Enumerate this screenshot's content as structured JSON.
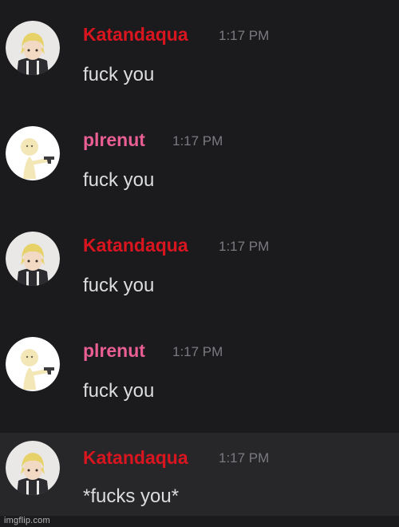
{
  "messages": [
    {
      "author": "Katandaqua",
      "author_color": "#d9151f",
      "time": "1:17 PM",
      "text": "fuck you",
      "avatar": "katandaqua-avatar"
    },
    {
      "author": "plrenut",
      "author_color": "#ea5f93",
      "time": "1:17 PM",
      "text": "fuck you",
      "avatar": "plrenut-avatar"
    },
    {
      "author": "Katandaqua",
      "author_color": "#d9151f",
      "time": "1:17 PM",
      "text": "fuck you",
      "avatar": "katandaqua-avatar"
    },
    {
      "author": "plrenut",
      "author_color": "#ea5f93",
      "time": "1:17 PM",
      "text": "fuck you",
      "avatar": "plrenut-avatar"
    },
    {
      "author": "Katandaqua",
      "author_color": "#d9151f",
      "time": "1:17 PM",
      "text": "*fucks you*",
      "avatar": "katandaqua-avatar"
    }
  ],
  "colors": {
    "background": "#1b1b1d",
    "hover_background": "#27272a",
    "message_text": "#dcdddf",
    "timestamp": "#7a7b80"
  },
  "watermark": "imgflip.com"
}
